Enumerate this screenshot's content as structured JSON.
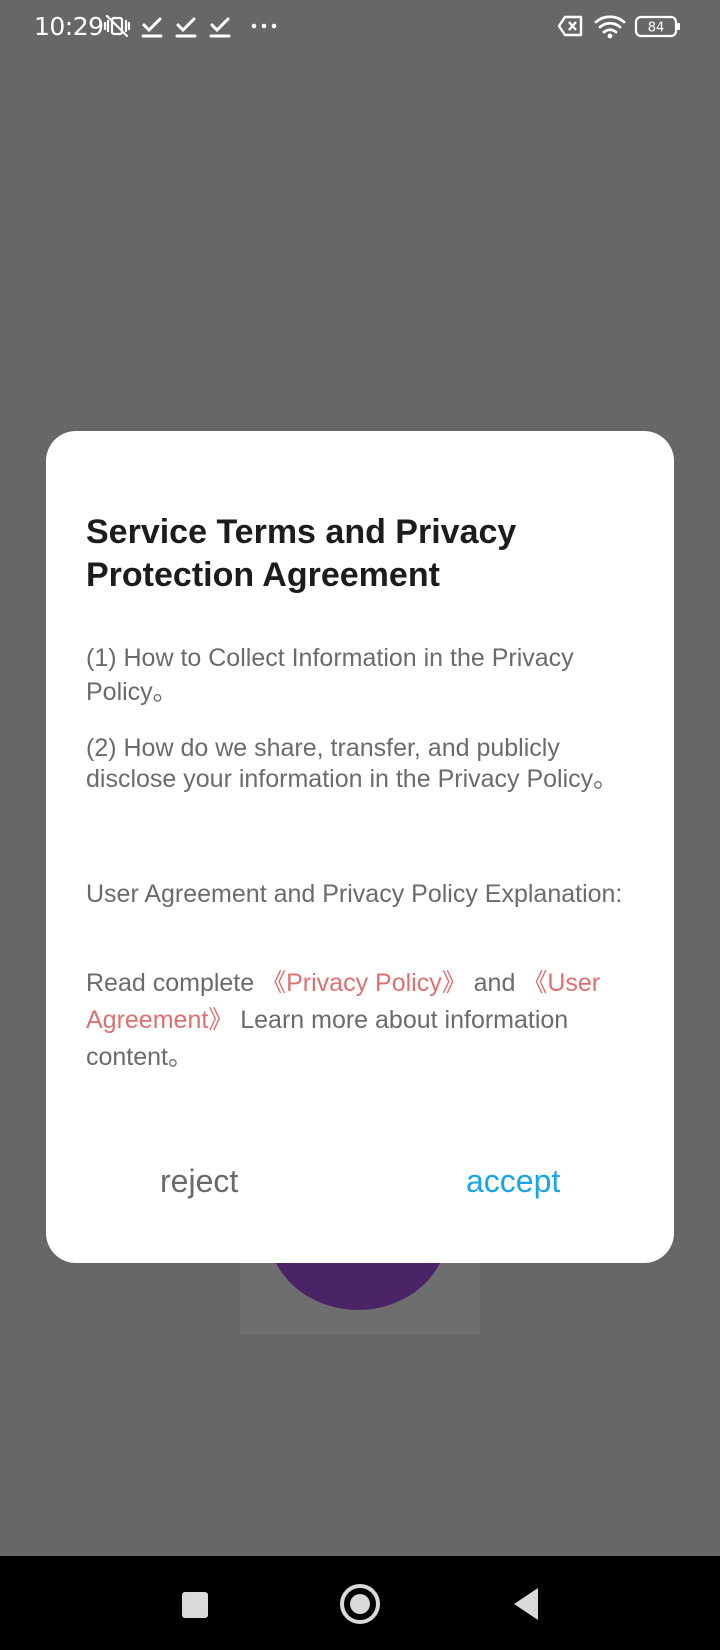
{
  "status_bar": {
    "time": "10:29",
    "battery": "84",
    "icons": [
      "vibrate-off-icon",
      "download-done-icon",
      "download-done-icon",
      "download-done-icon",
      "more-dots-icon",
      "sim-off-icon",
      "wifi-icon",
      "battery-icon"
    ]
  },
  "dialog": {
    "title": "Service Terms and Privacy Protection Agreement",
    "item1": "(1) How to Collect Information in the Privacy Policy。",
    "item2": "(2) How do we share, transfer, and publicly disclose your information in the Privacy Policy。",
    "explanation_heading": "User Agreement and Privacy Policy Explanation:",
    "read_prefix": "Read complete ",
    "privacy_link": "《Privacy Policy》",
    "and_text": " and ",
    "user_link": "《User Agreement》",
    "read_suffix": " Learn more about information content。",
    "reject_label": "reject",
    "accept_label": "accept"
  },
  "nav_bar": {
    "icons": [
      "recents-square-icon",
      "home-circle-icon",
      "back-triangle-icon"
    ]
  },
  "colors": {
    "scrim": "#676767",
    "link": "#e07070",
    "accept": "#1aa6e6"
  }
}
